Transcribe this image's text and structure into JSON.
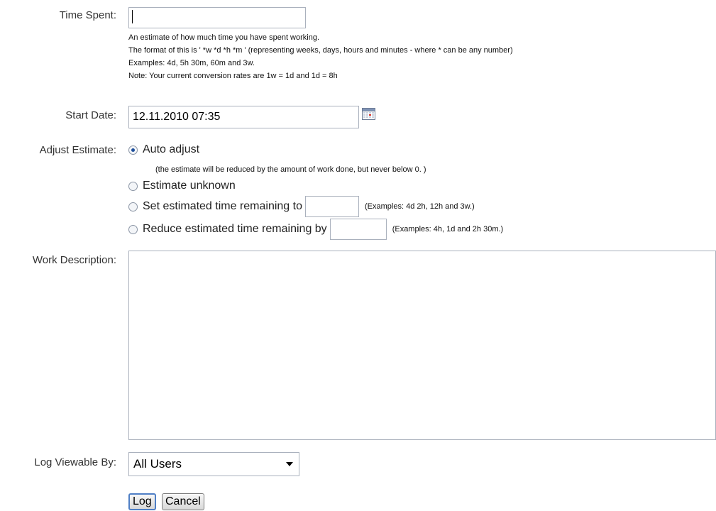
{
  "time_spent": {
    "label": "Time Spent:",
    "value": "",
    "help_lines": [
      "An estimate of how much time you have spent working.",
      "The format of this is ' *w *d *h *m ' (representing weeks, days, hours and minutes - where * can be any number)",
      "Examples: 4d, 5h 30m, 60m and 3w.",
      "Note: Your current conversion rates are 1w = 1d and 1d = 8h"
    ]
  },
  "start_date": {
    "label": "Start Date:",
    "value": "12.11.2010 07:35",
    "icon": "calendar-icon"
  },
  "adjust_estimate": {
    "label": "Adjust Estimate:",
    "options": [
      {
        "label": "Auto adjust",
        "checked": true
      },
      {
        "label": "Estimate unknown",
        "checked": false
      },
      {
        "label": "Set estimated time remaining to",
        "checked": false,
        "example": "(Examples: 4d 2h, 12h and 3w.)"
      },
      {
        "label": "Reduce estimated time remaining by",
        "checked": false,
        "example": "(Examples: 4h, 1d and 2h 30m.)"
      }
    ],
    "auto_note": "(the estimate will be reduced by the amount of work done, but never below 0. )"
  },
  "work_description": {
    "label": "Work Description:",
    "value": ""
  },
  "log_viewable_by": {
    "label": "Log Viewable By:",
    "selected": "All Users"
  },
  "buttons": {
    "log": "Log",
    "cancel": "Cancel"
  },
  "colors": {
    "input_border": "#aab1bd",
    "radio_dot": "#1e4f9b",
    "primary_button_border": "#4f7fc5"
  }
}
